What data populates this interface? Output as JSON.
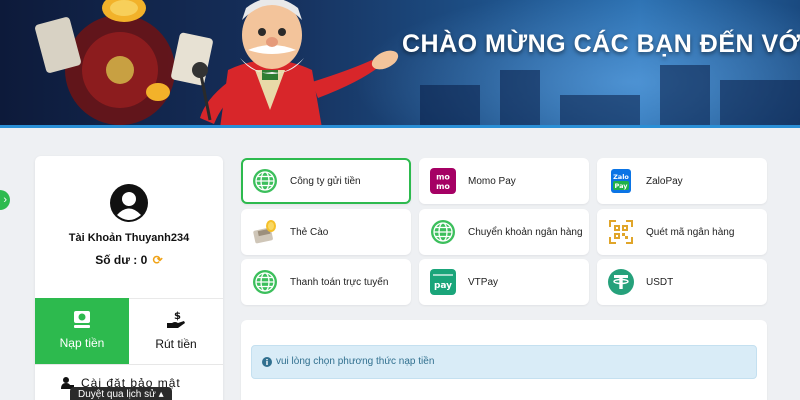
{
  "banner": {
    "title": "CHÀO MỪNG CÁC BẠN ĐẾN VỚI"
  },
  "profile": {
    "account_name": "Tài Khoản Thuyanh234",
    "balance_label": "Số dư :",
    "balance_value": "0",
    "refresh_icon": "refresh-icon"
  },
  "actions": {
    "deposit_label": "Nạp tiền",
    "withdraw_label": "Rút tiền"
  },
  "security": {
    "label": "Cài đặt bảo mật"
  },
  "tooltip": {
    "history": "Duyệt qua lịch sử"
  },
  "methods": [
    {
      "label": "Công ty gửi tiền",
      "icon": "globe-icon",
      "active": true
    },
    {
      "label": "Momo Pay",
      "icon": "momo-logo-icon",
      "active": false
    },
    {
      "label": "ZaloPay",
      "icon": "zalopay-logo-icon",
      "active": false
    },
    {
      "label": "Thẻ Cào",
      "icon": "scratch-card-icon",
      "active": false
    },
    {
      "label": "Chuyển khoản ngân hàng",
      "icon": "globe-icon",
      "active": false
    },
    {
      "label": "Quét mã ngân hàng",
      "icon": "qr-code-icon",
      "active": false
    },
    {
      "label": "Thanh toán trực tuyến",
      "icon": "globe-icon",
      "active": false
    },
    {
      "label": "VTPay",
      "icon": "vtpay-logo-icon",
      "active": false
    },
    {
      "label": "USDT",
      "icon": "tether-icon",
      "active": false
    }
  ],
  "info": {
    "message": "vui lòng chọn phương thức nạp tiền"
  },
  "colors": {
    "accent_green": "#2dba4e",
    "info_bg": "#d9ecf7",
    "info_text": "#31708f"
  }
}
